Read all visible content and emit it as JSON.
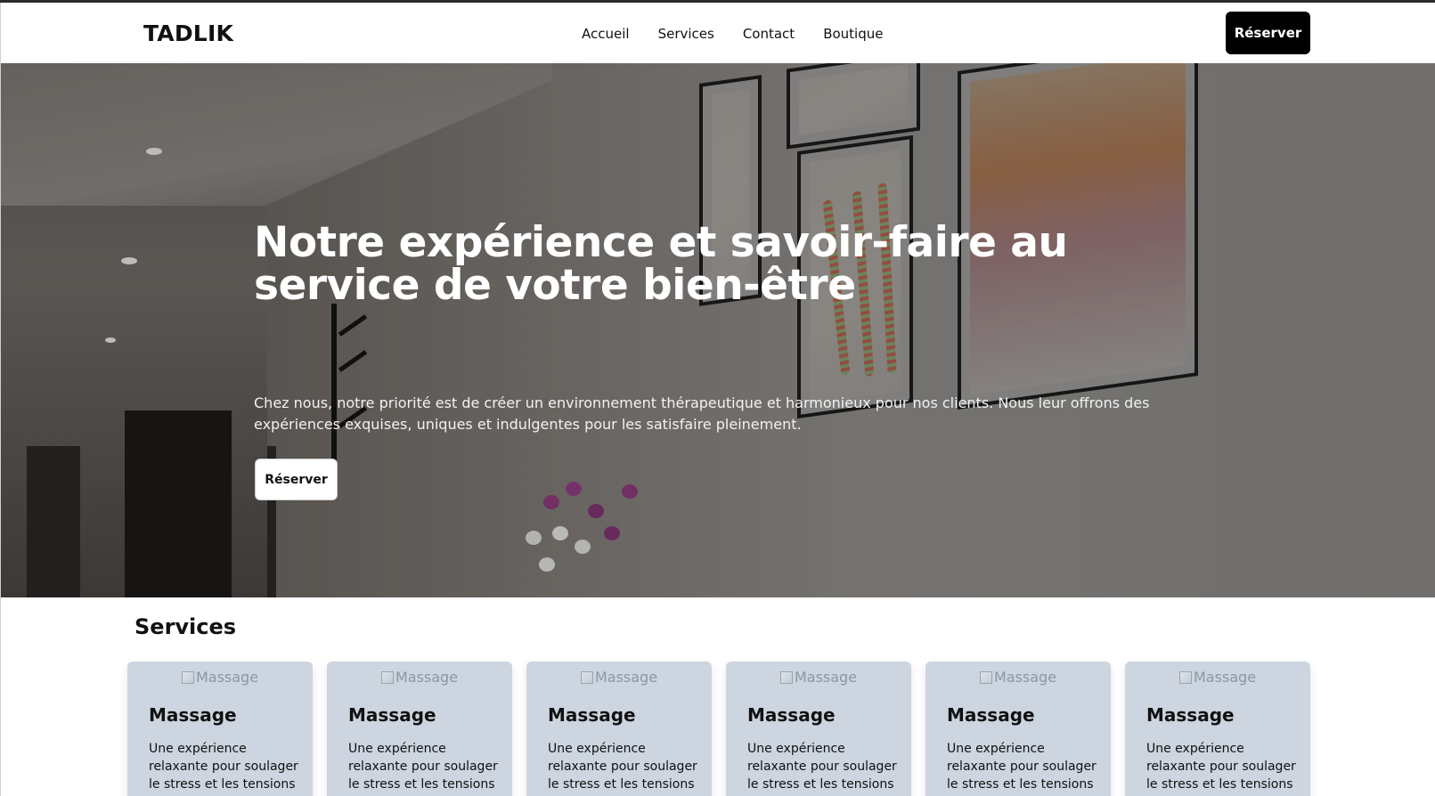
{
  "header": {
    "logo": "TADLIK",
    "nav": [
      "Accueil",
      "Services",
      "Contact",
      "Boutique"
    ],
    "cta_label": "Réserver"
  },
  "hero": {
    "title": "Notre expérience et savoir-faire au service de votre bien-être",
    "subtitle": "Chez nous, notre priorité est de créer un environnement thérapeutique et harmonieux pour nos clients. Nous leur offrons des expériences exquises, uniques et indulgentes pour les satisfaire pleinement.",
    "cta_label": "Réserver"
  },
  "services": {
    "heading": "Services",
    "cards": [
      {
        "img_alt": "Massage",
        "title": "Massage",
        "text": "Une expérience relaxante pour soulager le stress et les tensions"
      },
      {
        "img_alt": "Massage",
        "title": "Massage",
        "text": "Une expérience relaxante pour soulager le stress et les tensions"
      },
      {
        "img_alt": "Massage",
        "title": "Massage",
        "text": "Une expérience relaxante pour soulager le stress et les tensions"
      },
      {
        "img_alt": "Massage",
        "title": "Massage",
        "text": "Une expérience relaxante pour soulager le stress et les tensions"
      },
      {
        "img_alt": "Massage",
        "title": "Massage",
        "text": "Une expérience relaxante pour soulager le stress et les tensions"
      },
      {
        "img_alt": "Massage",
        "title": "Massage",
        "text": "Une expérience relaxante pour soulager le stress et les tensions"
      }
    ]
  },
  "colors": {
    "brand_black": "#000000",
    "card_bg": "#ccd5e0"
  }
}
